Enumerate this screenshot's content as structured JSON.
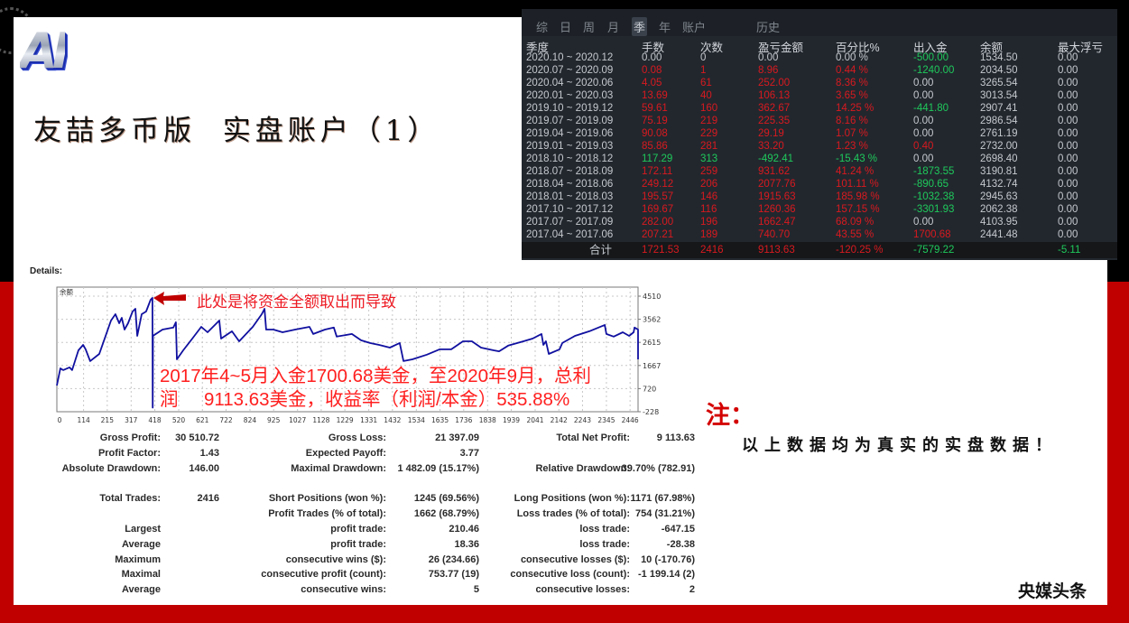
{
  "header": {
    "logo_text": "AI",
    "title": "友喆多币版  实盘账户（1）"
  },
  "palette": {
    "red": "#d81a1f",
    "green": "#1fc95b",
    "gray": "#c5c9ce",
    "accent_red": "#c00000",
    "annotation_red": "#ff1f1f",
    "line_blue": "#1010a0"
  },
  "quarterly_panel": {
    "tabs": [
      {
        "label": "综",
        "active": false
      },
      {
        "label": "日",
        "active": false
      },
      {
        "label": "周",
        "active": false
      },
      {
        "label": "月",
        "active": false
      },
      {
        "label": "季",
        "active": true
      },
      {
        "label": "年",
        "active": false
      },
      {
        "label": "账户",
        "active": false
      },
      {
        "label": "历史",
        "active": false
      }
    ],
    "columns": [
      "季度",
      "手数",
      "次数",
      "盈亏金额",
      "百分比%",
      "出入金",
      "余额",
      "最大浮亏"
    ],
    "rows": [
      {
        "period": "2020.10 ~ 2020.12",
        "cells": [
          {
            "v": "0.00",
            "t": "n"
          },
          {
            "v": "0",
            "t": "n"
          },
          {
            "v": "0.00",
            "t": "n"
          },
          {
            "v": "0.00 %",
            "t": "n"
          },
          {
            "v": "-500.00",
            "t": "g"
          },
          {
            "v": "1534.50",
            "t": "n"
          },
          {
            "v": "0.00",
            "t": "n"
          }
        ]
      },
      {
        "period": "2020.07 ~ 2020.09",
        "cells": [
          {
            "v": "0.08",
            "t": "r"
          },
          {
            "v": "1",
            "t": "r"
          },
          {
            "v": "8.96",
            "t": "r"
          },
          {
            "v": "0.44 %",
            "t": "r"
          },
          {
            "v": "-1240.00",
            "t": "g"
          },
          {
            "v": "2034.50",
            "t": "n"
          },
          {
            "v": "0.00",
            "t": "n"
          }
        ]
      },
      {
        "period": "2020.04 ~ 2020.06",
        "cells": [
          {
            "v": "4.05",
            "t": "r"
          },
          {
            "v": "61",
            "t": "r"
          },
          {
            "v": "252.00",
            "t": "r"
          },
          {
            "v": "8.36 %",
            "t": "r"
          },
          {
            "v": "0.00",
            "t": "n"
          },
          {
            "v": "3265.54",
            "t": "n"
          },
          {
            "v": "0.00",
            "t": "n"
          }
        ]
      },
      {
        "period": "2020.01 ~ 2020.03",
        "cells": [
          {
            "v": "13.69",
            "t": "r"
          },
          {
            "v": "40",
            "t": "r"
          },
          {
            "v": "106.13",
            "t": "r"
          },
          {
            "v": "3.65 %",
            "t": "r"
          },
          {
            "v": "0.00",
            "t": "n"
          },
          {
            "v": "3013.54",
            "t": "n"
          },
          {
            "v": "0.00",
            "t": "n"
          }
        ]
      },
      {
        "period": "2019.10 ~ 2019.12",
        "cells": [
          {
            "v": "59.61",
            "t": "r"
          },
          {
            "v": "160",
            "t": "r"
          },
          {
            "v": "362.67",
            "t": "r"
          },
          {
            "v": "14.25 %",
            "t": "r"
          },
          {
            "v": "-441.80",
            "t": "g"
          },
          {
            "v": "2907.41",
            "t": "n"
          },
          {
            "v": "0.00",
            "t": "n"
          }
        ]
      },
      {
        "period": "2019.07 ~ 2019.09",
        "cells": [
          {
            "v": "75.19",
            "t": "r"
          },
          {
            "v": "219",
            "t": "r"
          },
          {
            "v": "225.35",
            "t": "r"
          },
          {
            "v": "8.16 %",
            "t": "r"
          },
          {
            "v": "0.00",
            "t": "n"
          },
          {
            "v": "2986.54",
            "t": "n"
          },
          {
            "v": "0.00",
            "t": "n"
          }
        ]
      },
      {
        "period": "2019.04 ~ 2019.06",
        "cells": [
          {
            "v": "90.08",
            "t": "r"
          },
          {
            "v": "229",
            "t": "r"
          },
          {
            "v": "29.19",
            "t": "r"
          },
          {
            "v": "1.07 %",
            "t": "r"
          },
          {
            "v": "0.00",
            "t": "n"
          },
          {
            "v": "2761.19",
            "t": "n"
          },
          {
            "v": "0.00",
            "t": "n"
          }
        ]
      },
      {
        "period": "2019.01 ~ 2019.03",
        "cells": [
          {
            "v": "85.86",
            "t": "r"
          },
          {
            "v": "281",
            "t": "r"
          },
          {
            "v": "33.20",
            "t": "r"
          },
          {
            "v": "1.23 %",
            "t": "r"
          },
          {
            "v": "0.40",
            "t": "r"
          },
          {
            "v": "2732.00",
            "t": "n"
          },
          {
            "v": "0.00",
            "t": "n"
          }
        ]
      },
      {
        "period": "2018.10 ~ 2018.12",
        "cells": [
          {
            "v": "117.29",
            "t": "g"
          },
          {
            "v": "313",
            "t": "g"
          },
          {
            "v": "-492.41",
            "t": "g"
          },
          {
            "v": "-15.43 %",
            "t": "g"
          },
          {
            "v": "0.00",
            "t": "n"
          },
          {
            "v": "2698.40",
            "t": "n"
          },
          {
            "v": "0.00",
            "t": "n"
          }
        ]
      },
      {
        "period": "2018.07 ~ 2018.09",
        "cells": [
          {
            "v": "172.11",
            "t": "r"
          },
          {
            "v": "259",
            "t": "r"
          },
          {
            "v": "931.62",
            "t": "r"
          },
          {
            "v": "41.24 %",
            "t": "r"
          },
          {
            "v": "-1873.55",
            "t": "g"
          },
          {
            "v": "3190.81",
            "t": "n"
          },
          {
            "v": "0.00",
            "t": "n"
          }
        ]
      },
      {
        "period": "2018.04 ~ 2018.06",
        "cells": [
          {
            "v": "249.12",
            "t": "r"
          },
          {
            "v": "206",
            "t": "r"
          },
          {
            "v": "2077.76",
            "t": "r"
          },
          {
            "v": "101.11 %",
            "t": "r"
          },
          {
            "v": "-890.65",
            "t": "g"
          },
          {
            "v": "4132.74",
            "t": "n"
          },
          {
            "v": "0.00",
            "t": "n"
          }
        ]
      },
      {
        "period": "2018.01 ~ 2018.03",
        "cells": [
          {
            "v": "195.57",
            "t": "r"
          },
          {
            "v": "146",
            "t": "r"
          },
          {
            "v": "1915.63",
            "t": "r"
          },
          {
            "v": "185.98 %",
            "t": "r"
          },
          {
            "v": "-1032.38",
            "t": "g"
          },
          {
            "v": "2945.63",
            "t": "n"
          },
          {
            "v": "0.00",
            "t": "n"
          }
        ]
      },
      {
        "period": "2017.10 ~ 2017.12",
        "cells": [
          {
            "v": "169.67",
            "t": "r"
          },
          {
            "v": "116",
            "t": "r"
          },
          {
            "v": "1260.36",
            "t": "r"
          },
          {
            "v": "157.15 %",
            "t": "r"
          },
          {
            "v": "-3301.93",
            "t": "g"
          },
          {
            "v": "2062.38",
            "t": "n"
          },
          {
            "v": "0.00",
            "t": "n"
          }
        ]
      },
      {
        "period": "2017.07 ~ 2017.09",
        "cells": [
          {
            "v": "282.00",
            "t": "r"
          },
          {
            "v": "196",
            "t": "r"
          },
          {
            "v": "1662.47",
            "t": "r"
          },
          {
            "v": "68.09 %",
            "t": "r"
          },
          {
            "v": "0.00",
            "t": "n"
          },
          {
            "v": "4103.95",
            "t": "n"
          },
          {
            "v": "0.00",
            "t": "n"
          }
        ]
      },
      {
        "period": "2017.04 ~ 2017.06",
        "cells": [
          {
            "v": "207.21",
            "t": "r"
          },
          {
            "v": "189",
            "t": "r"
          },
          {
            "v": "740.70",
            "t": "r"
          },
          {
            "v": "43.55 %",
            "t": "r"
          },
          {
            "v": "1700.68",
            "t": "r"
          },
          {
            "v": "2441.48",
            "t": "n"
          },
          {
            "v": "0.00",
            "t": "n"
          }
        ]
      }
    ],
    "total": {
      "label": "合计",
      "cells": [
        {
          "v": "1721.53",
          "t": "r"
        },
        {
          "v": "2416",
          "t": "r"
        },
        {
          "v": "9113.63",
          "t": "r"
        },
        {
          "v": "-120.25 %",
          "t": "r"
        },
        {
          "v": "-7579.22",
          "t": "g"
        },
        {
          "v": "",
          "t": "n"
        },
        {
          "v": "-5.11",
          "t": "g"
        }
      ]
    }
  },
  "details": {
    "label": "Details:",
    "stats": [
      {
        "l1": "Gross Profit:",
        "v1": "30 510.72",
        "l2": "Gross Loss:",
        "v2": "21 397.09",
        "l3": "Total Net Profit:",
        "v3": "9 113.63"
      },
      {
        "l1": "Profit Factor:",
        "v1": "1.43",
        "l2": "Expected Payoff:",
        "v2": "3.77",
        "l3": "",
        "v3": ""
      },
      {
        "l1": "Absolute Drawdown:",
        "v1": "146.00",
        "l2": "Maximal Drawdown:",
        "v2": "1 482.09 (15.17%)",
        "l3": "Relative Drawdown:",
        "v3": "39.70% (782.91)"
      },
      {
        "l1": "Total Trades:",
        "v1": "2416",
        "l2": "Short Positions (won %):",
        "v2": "1245 (69.56%)",
        "l3": "Long Positions (won %):",
        "v3": "1171 (67.98%)"
      },
      {
        "l1": "",
        "v1": "",
        "l2": "Profit Trades (% of total):",
        "v2": "1662 (68.79%)",
        "l3": "Loss trades (% of total):",
        "v3": "754 (31.21%)"
      },
      {
        "l1": "Largest",
        "v1": "",
        "l2": "profit trade:",
        "v2": "210.46",
        "l3": "loss trade:",
        "v3": "-647.15"
      },
      {
        "l1": "Average",
        "v1": "",
        "l2": "profit trade:",
        "v2": "18.36",
        "l3": "loss trade:",
        "v3": "-28.38"
      },
      {
        "l1": "Maximum",
        "v1": "",
        "l2": "consecutive wins ($):",
        "v2": "26 (234.66)",
        "l3": "consecutive losses ($):",
        "v3": "10 (-170.76)"
      },
      {
        "l1": "Maximal",
        "v1": "",
        "l2": "consecutive profit (count):",
        "v2": "753.77 (19)",
        "l3": "consecutive loss (count):",
        "v3": "-1 199.14 (2)"
      },
      {
        "l1": "Average",
        "v1": "",
        "l2": "consecutive wins:",
        "v2": "5",
        "l3": "consecutive losses:",
        "v3": "2"
      }
    ]
  },
  "chart_data": {
    "type": "line",
    "title": "",
    "corner_label": "余额",
    "xlabel": "",
    "ylabel": "",
    "grid": true,
    "legend": "none",
    "xlim": [
      0,
      2480
    ],
    "ylim": [
      -228,
      4880
    ],
    "x_ticks": [
      0,
      114,
      215,
      317,
      418,
      520,
      621,
      722,
      824,
      925,
      1027,
      1128,
      1229,
      1331,
      1432,
      1534,
      1635,
      1736,
      1838,
      1939,
      2041,
      2142,
      2243,
      2345,
      2446
    ],
    "y_ticks": [
      4510,
      3562,
      2615,
      1667,
      720,
      -228
    ],
    "series": [
      {
        "name": "余额",
        "x": [
          0,
          15,
          27,
          54,
          65,
          92,
          112,
          123,
          142,
          181,
          231,
          250,
          266,
          277,
          289,
          304,
          323,
          335,
          343,
          362,
          381,
          400,
          408,
          409,
          410,
          451,
          497,
          508,
          512,
          539,
          578,
          616,
          643,
          693,
          701,
          747,
          778,
          836,
          874,
          886,
          893,
          924,
          963,
          1017,
          1078,
          1094,
          1144,
          1182,
          1194,
          1259,
          1298,
          1336,
          1375,
          1421,
          1463,
          1479,
          1517,
          1579,
          1633,
          1683,
          1733,
          1771,
          1810,
          1864,
          1887,
          1926,
          1991,
          2030,
          2068,
          2076,
          2087,
          2099,
          2145,
          2157,
          2211,
          2272,
          2338,
          2345,
          2376,
          2415,
          2442,
          2461,
          2465,
          2480,
          2480
        ],
        "y": [
          850,
          1550,
          1480,
          1590,
          1480,
          2290,
          2510,
          2330,
          1850,
          2140,
          3510,
          3770,
          3400,
          3620,
          3140,
          3400,
          3880,
          3990,
          2880,
          3770,
          3880,
          4360,
          4440,
          -60,
          2880,
          3140,
          3220,
          3440,
          1920,
          2290,
          2770,
          3250,
          3030,
          3510,
          2770,
          3070,
          2660,
          3250,
          3770,
          3990,
          3140,
          3140,
          3030,
          3140,
          3250,
          2960,
          3140,
          3220,
          2850,
          2960,
          2700,
          2590,
          2510,
          2400,
          2590,
          1850,
          1920,
          2110,
          2330,
          2330,
          2660,
          2660,
          2400,
          2290,
          2250,
          2480,
          2660,
          2770,
          2960,
          2510,
          2660,
          2140,
          2330,
          2590,
          2880,
          3070,
          3330,
          2960,
          2850,
          3030,
          2880,
          3030,
          3220,
          3140,
          1920
        ]
      }
    ]
  },
  "annotations": {
    "withdrawal_note": "此处是将资金全额取出而导致",
    "summary": "2017年4~5月入金1700.68美金，至2020年9月，总利\n润     9113.63美金，收益率（利润/本金）535.88%"
  },
  "note": {
    "mark": "注：",
    "text": "以上数据均为真实的实盘数据！"
  },
  "watermark": "央媒头条"
}
